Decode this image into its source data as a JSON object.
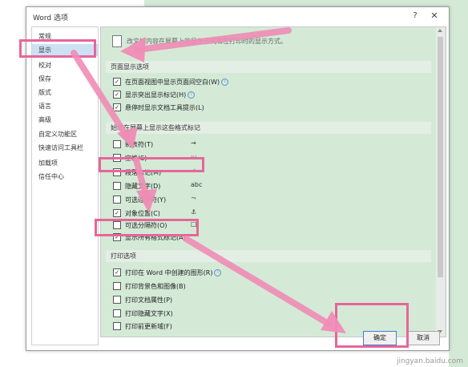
{
  "dialog": {
    "title": "Word 选项",
    "help": "?",
    "close": "✕"
  },
  "sidebar": {
    "items": [
      {
        "label": "常规"
      },
      {
        "label": "显示",
        "active": true
      },
      {
        "label": "校对"
      },
      {
        "label": "保存"
      },
      {
        "label": "版式"
      },
      {
        "label": "语言"
      },
      {
        "label": "高级"
      },
      {
        "label": "自定义功能区"
      },
      {
        "label": "快速访问工具栏"
      },
      {
        "label": "加载项"
      },
      {
        "label": "信任中心"
      }
    ]
  },
  "content": {
    "intro": "改文档内容在屏幕上的显示方式和在打印时的显示方式。",
    "page_display": {
      "header": "页面显示选项",
      "options": [
        {
          "label": "在页面视图中显示页面间空白(W)",
          "checked": true,
          "info": true
        },
        {
          "label": "显示突出显示标记(H)",
          "checked": true,
          "info": true
        },
        {
          "label": "悬停时显示文档工具提示(L)",
          "checked": true
        }
      ]
    },
    "format_marks": {
      "header": "始终在屏幕上显示这些格式标记",
      "options": [
        {
          "label": "制表符(T)",
          "checked": false,
          "symbol": "→"
        },
        {
          "label": "空格(S)",
          "checked": false,
          "symbol": "···"
        },
        {
          "label": "段落标记(M)",
          "checked": false,
          "symbol": "↵"
        },
        {
          "label": "隐藏文字(D)",
          "checked": false,
          "symbol": "abc"
        },
        {
          "label": "可选连字符(Y)",
          "checked": false,
          "symbol": "¬"
        },
        {
          "label": "对象位置(C)",
          "checked": true,
          "symbol": "⚓"
        },
        {
          "label": "可选分隔符(O)",
          "checked": false,
          "symbol": "□"
        },
        {
          "label": "显示所有格式标记(A)",
          "checked": true
        }
      ]
    },
    "print": {
      "header": "打印选项",
      "options": [
        {
          "label": "打印在 Word 中创建的图形(R)",
          "checked": true,
          "info": true
        },
        {
          "label": "打印背景色和图像(B)",
          "checked": false
        },
        {
          "label": "打印文档属性(P)",
          "checked": false
        },
        {
          "label": "打印隐藏文字(X)",
          "checked": false
        },
        {
          "label": "打印前更新域(F)",
          "checked": false
        }
      ]
    }
  },
  "footer": {
    "ok": "确定",
    "cancel": "取消"
  },
  "watermark": "jingyan.baidu.com",
  "colors": {
    "annotation": "#e6669a",
    "content_bg": "#d4ead7",
    "active_nav": "#cde1f5"
  }
}
